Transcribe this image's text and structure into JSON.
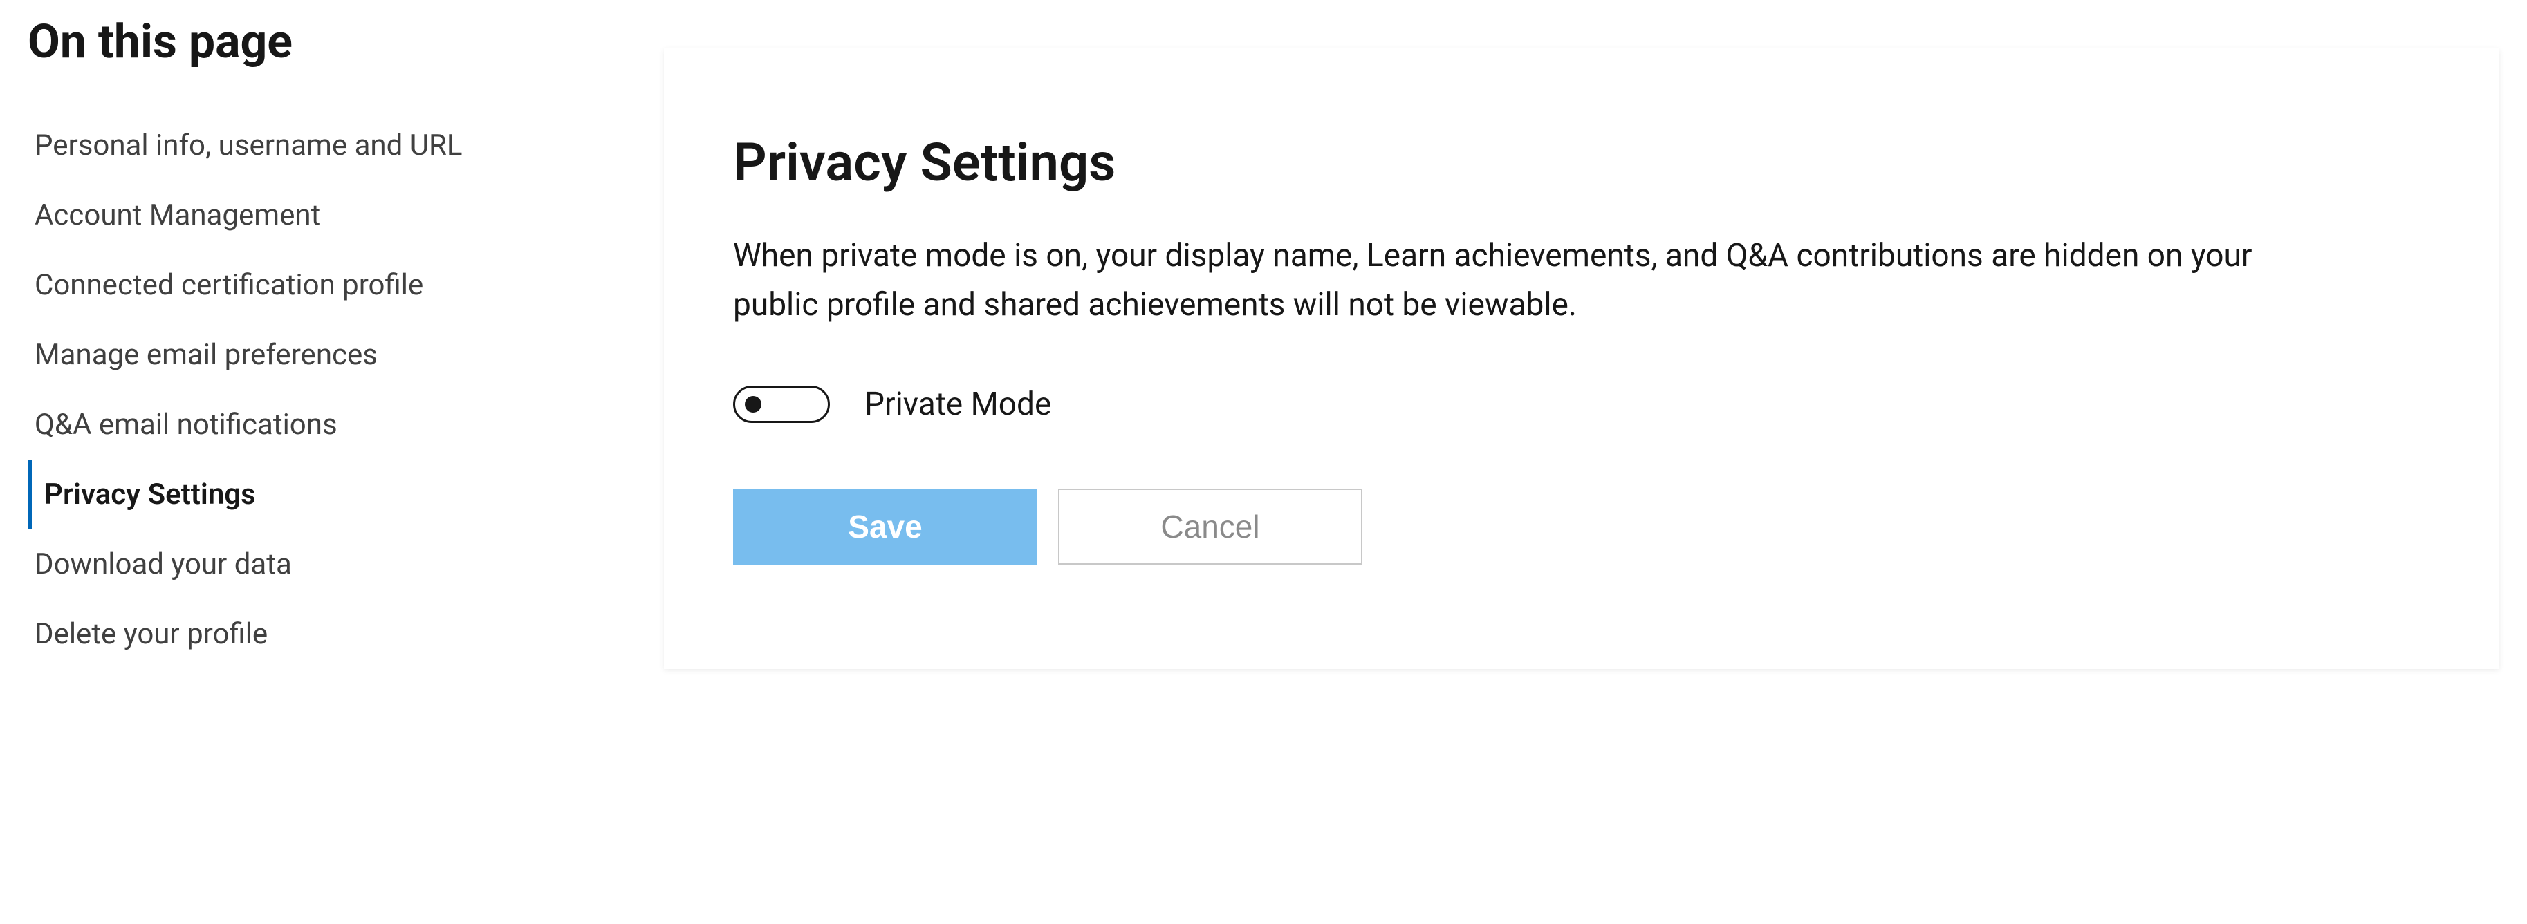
{
  "sidebar": {
    "heading": "On this page",
    "items": [
      {
        "label": "Personal info, username and URL",
        "active": false
      },
      {
        "label": "Account Management",
        "active": false
      },
      {
        "label": "Connected certification profile",
        "active": false
      },
      {
        "label": "Manage email preferences",
        "active": false
      },
      {
        "label": "Q&A email notifications",
        "active": false
      },
      {
        "label": "Privacy Settings",
        "active": true
      },
      {
        "label": "Download your data",
        "active": false
      },
      {
        "label": "Delete your profile",
        "active": false
      }
    ]
  },
  "main": {
    "title": "Privacy Settings",
    "description": "When private mode is on, your display name, Learn achievements, and Q&A contributions are hidden on your public profile and shared achievements will not be viewable.",
    "toggle": {
      "label": "Private Mode",
      "state": "off"
    },
    "buttons": {
      "save": "Save",
      "cancel": "Cancel"
    }
  }
}
